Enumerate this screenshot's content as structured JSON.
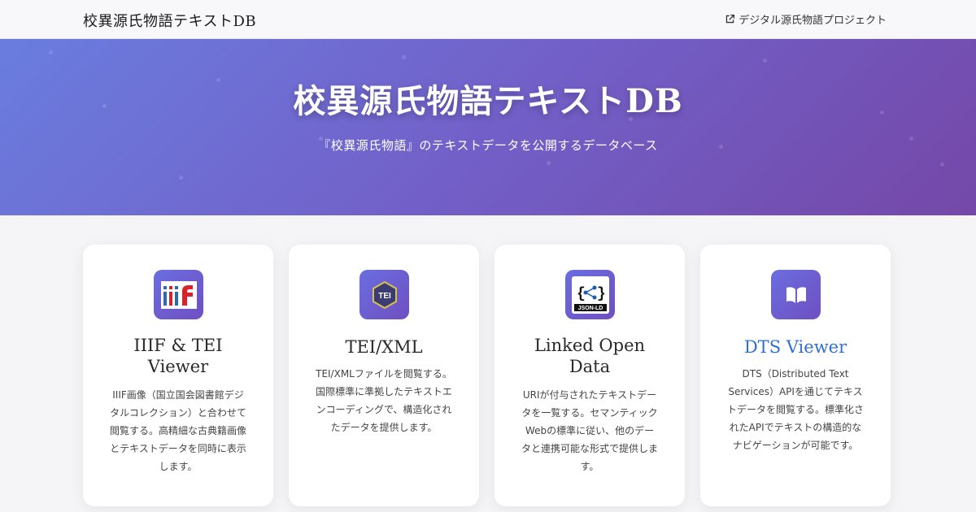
{
  "header": {
    "site_title": "校異源氏物語テキストDB",
    "external_link": "デジタル源氏物語プロジェクト"
  },
  "hero": {
    "title": "校異源氏物語テキストDB",
    "subtitle": "『校異源氏物語』のテキストデータを公開するデータベース"
  },
  "cards": [
    {
      "icon": "iiif-icon",
      "icon_text": "iiif",
      "title": "IIIF & TEI Viewer",
      "description": "IIIF画像（国立国会図書館デジタルコレクション）と合わせて閲覧する。高精細な古典籍画像とテキストデータを同時に表示します。"
    },
    {
      "icon": "tei-icon",
      "icon_text": "TEI",
      "title": "TEI/XML",
      "description": "TEI/XMLファイルを閲覧する。国際標準に準拠したテキストエンコーディングで、構造化されたデータを提供します。"
    },
    {
      "icon": "json-ld-icon",
      "icon_text": "JSON-LD",
      "title": "Linked Open Data",
      "description": "URIが付与されたテキストデータを一覧する。セマンティックWebの標準に従い、他のデータと連携可能な形式で提供します。"
    },
    {
      "icon": "book-icon",
      "title": "DTS Viewer",
      "description": "DTS（Distributed Text Services）APIを通じてテキストデータを閲覧する。標準化されたAPIでテキストの構造的なナビゲーションが可能です。"
    }
  ],
  "colors": {
    "hero_gradient_start": "#6a7ddf",
    "hero_gradient_end": "#7448a8",
    "icon_gradient_start": "#6a6ee0",
    "icon_gradient_end": "#6f4fc1",
    "link_title": "#2f6fd6"
  }
}
